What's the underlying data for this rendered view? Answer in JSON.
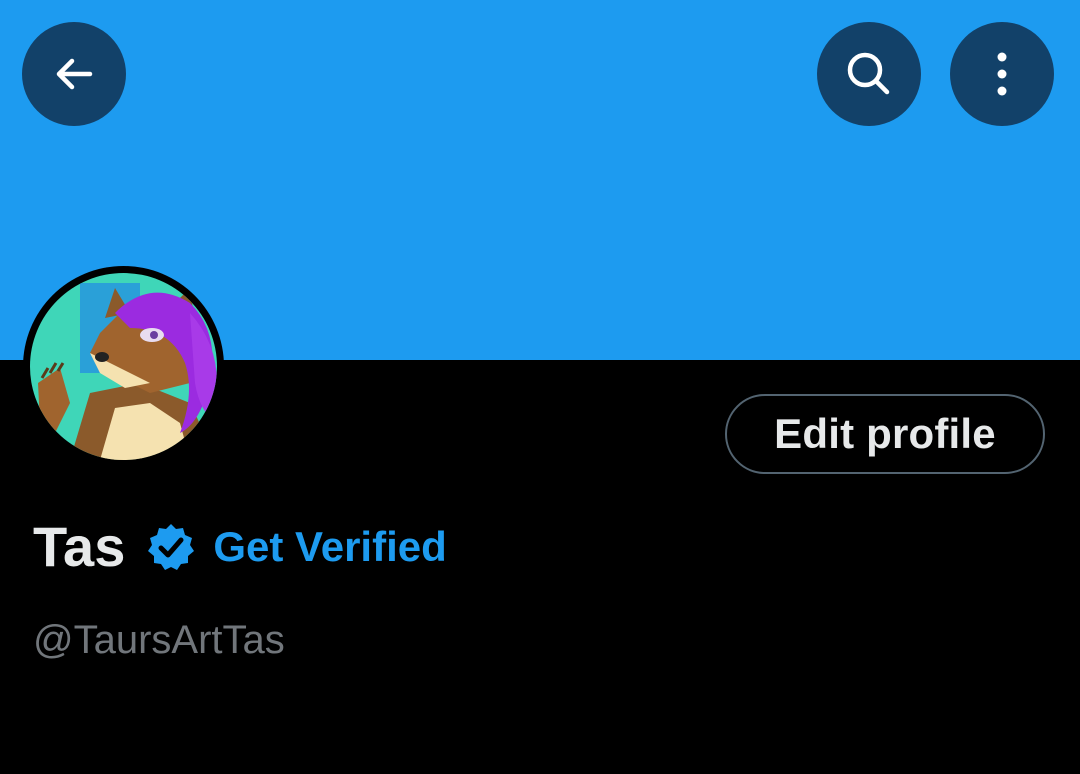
{
  "header": {
    "back_icon": "arrow-left-icon",
    "search_icon": "search-icon",
    "more_icon": "more-vertical-icon",
    "banner_color": "#1d9bf0"
  },
  "profile": {
    "display_name": "Tas",
    "verified_icon": "verified-badge-icon",
    "get_verified_label": "Get Verified",
    "handle": "@TaursArtTas",
    "edit_profile_label": "Edit profile",
    "avatar": "avatar-image"
  },
  "colors": {
    "accent": "#1d9bf0",
    "text_primary": "#e7e9ea",
    "text_secondary": "#71767b",
    "background": "#000000"
  }
}
